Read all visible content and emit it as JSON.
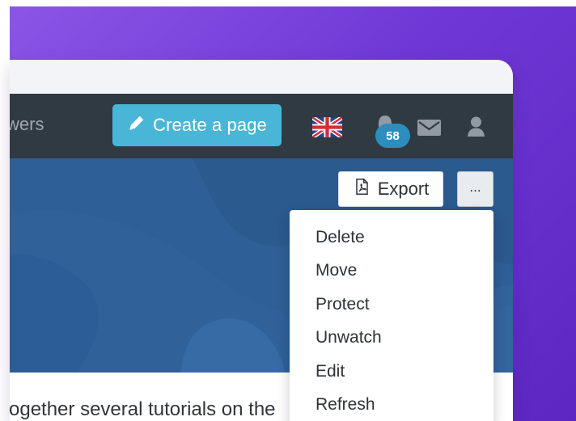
{
  "topbar": {
    "nav_partial": "wers",
    "create_button": "Create a page",
    "notification_count": "58"
  },
  "page": {
    "export_button": "Export",
    "more_button": "...",
    "content_partial": "ogether several tutorials on the"
  },
  "menu": {
    "items": [
      {
        "label": "Delete"
      },
      {
        "label": "Move"
      },
      {
        "label": "Protect"
      },
      {
        "label": "Unwatch"
      },
      {
        "label": "Edit"
      },
      {
        "label": "Refresh"
      }
    ]
  },
  "icons": {
    "create": "pencil-icon",
    "language": "uk-flag-icon",
    "notifications": "bell-icon",
    "messages": "mail-icon",
    "account": "user-icon",
    "export": "pdf-icon"
  },
  "colors": {
    "background_purple": "#6f38d6",
    "topbar": "#2f3a43",
    "create_button": "#4ab6d7",
    "hero": "#2e5f96",
    "badge": "#2d8dbd"
  }
}
